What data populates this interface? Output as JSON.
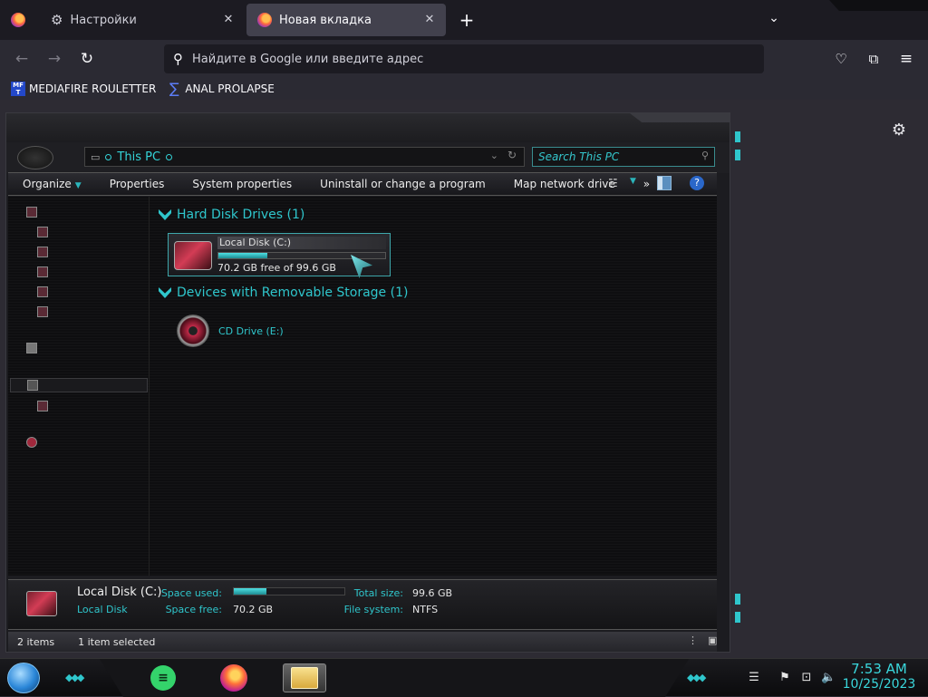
{
  "browser": {
    "tabs": [
      {
        "label": "Настройки",
        "state": "inactive"
      },
      {
        "label": "Новая вкладка",
        "state": "active"
      }
    ],
    "address_placeholder": "Найдите в Google или введите адрес",
    "bookmarks": [
      {
        "label": "MEDIAFIRE ROULETTER",
        "icon": "mediafire-icon"
      },
      {
        "label": "ANAL PROLAPSE",
        "icon": "sigma-icon"
      }
    ]
  },
  "explorer": {
    "breadcrumb": "This PC",
    "search_placeholder": "Search This PC",
    "toolbar": {
      "organize": "Organize",
      "properties": "Properties",
      "system_properties": "System properties",
      "uninstall": "Uninstall or change a program",
      "map_drive": "Map network drive",
      "more": "»"
    },
    "groups": {
      "hdd": "Hard Disk Drives (1)",
      "removable": "Devices with Removable Storage (1)"
    },
    "drive_c": {
      "name": "Local Disk (C:)",
      "free_text": "70.2 GB free of 99.6 GB",
      "used_fraction": 0.295
    },
    "drive_e": {
      "name": "CD Drive (E:)"
    },
    "details": {
      "title": "Local Disk (C:)",
      "subtitle": "Local Disk",
      "space_used_label": "Space used:",
      "space_free_label": "Space free:",
      "space_free_value": "70.2 GB",
      "total_size_label": "Total size:",
      "total_size_value": "99.6 GB",
      "file_system_label": "File system:",
      "file_system_value": "NTFS",
      "used_fraction": 0.295
    },
    "status": {
      "items": "2 items",
      "selected": "1 item selected"
    }
  },
  "taskbar": {
    "time": "7:53 AM",
    "date": "10/25/2023"
  },
  "colors": {
    "accent_teal": "#2fc6cc",
    "browser_bg": "#2b2a33"
  }
}
